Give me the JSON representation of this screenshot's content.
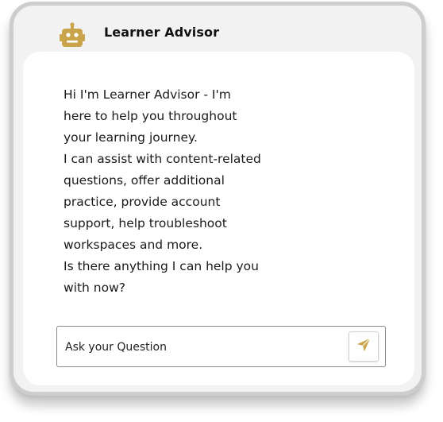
{
  "header": {
    "title": "Learner Advisor",
    "icon": "robot-icon"
  },
  "chat": {
    "message": "Hi  I'm Learner Advisor - I'm\nhere to help you throughout\nyour learning journey.\nI can assist with content-related\nquestions, offer additional\npractice, provide account\nsupport, help troubleshoot\nworkspaces and more.\nIs there anything I can help you\nwith now?"
  },
  "input": {
    "placeholder": "Ask your Question",
    "value": ""
  },
  "send_button": {
    "icon": "send-icon"
  },
  "colors": {
    "accent": "#c9a44a",
    "frame_border": "#cdcdcd",
    "frame_bg": "#f2f2f2",
    "panel_bg": "#ffffff",
    "text": "#1a1a1a"
  }
}
